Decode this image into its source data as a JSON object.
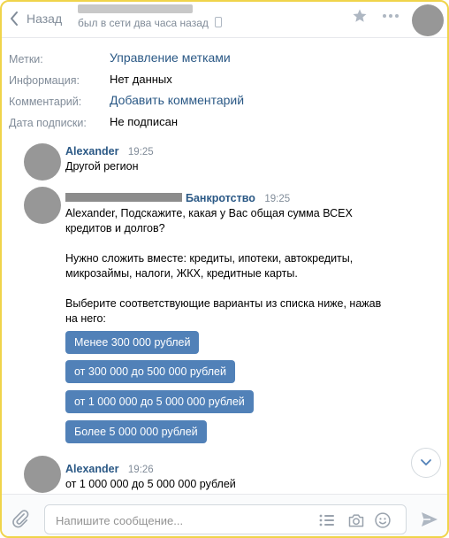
{
  "header": {
    "back_label": "Назад",
    "last_seen": "был в сети два часа назад"
  },
  "info": {
    "tags_label": "Метки:",
    "tags_value": "Управление метками",
    "information_label": "Информация:",
    "information_value": "Нет данных",
    "comment_label": "Комментарий:",
    "comment_value": "Добавить комментарий",
    "subscription_label": "Дата подписки:",
    "subscription_value": "Не подписан"
  },
  "messages": [
    {
      "author": "Alexander",
      "time": "19:25",
      "text": "Другой регион"
    },
    {
      "author": "Банкротство",
      "time": "19:25",
      "lines": [
        "Alexander, Подскажите, какая у Вас общая сумма ВСЕХ",
        "кредитов и долгов?",
        "",
        "Нужно сложить вместе: кредиты, ипотеки, автокредиты,",
        "микрозаймы, налоги, ЖКХ, кредитные карты.",
        "",
        "Выберите соответствующие варианты из списка ниже, нажав",
        "на него:"
      ],
      "buttons": [
        "Менее 300 000 рублей",
        "от 300 000 до 500 000 рублей",
        "от 1 000 000 до 5 000 000 рублей",
        "Более 5 000 000 рублей"
      ]
    },
    {
      "author": "Alexander",
      "time": "19:26",
      "text": "от 1 000 000 до 5 000 000 рублей"
    }
  ],
  "composer": {
    "placeholder": "Напишите сообщение..."
  },
  "colors": {
    "link": "#2a5885",
    "button": "#5181b8",
    "muted": "#818c99",
    "frame": "#f0d44a"
  }
}
